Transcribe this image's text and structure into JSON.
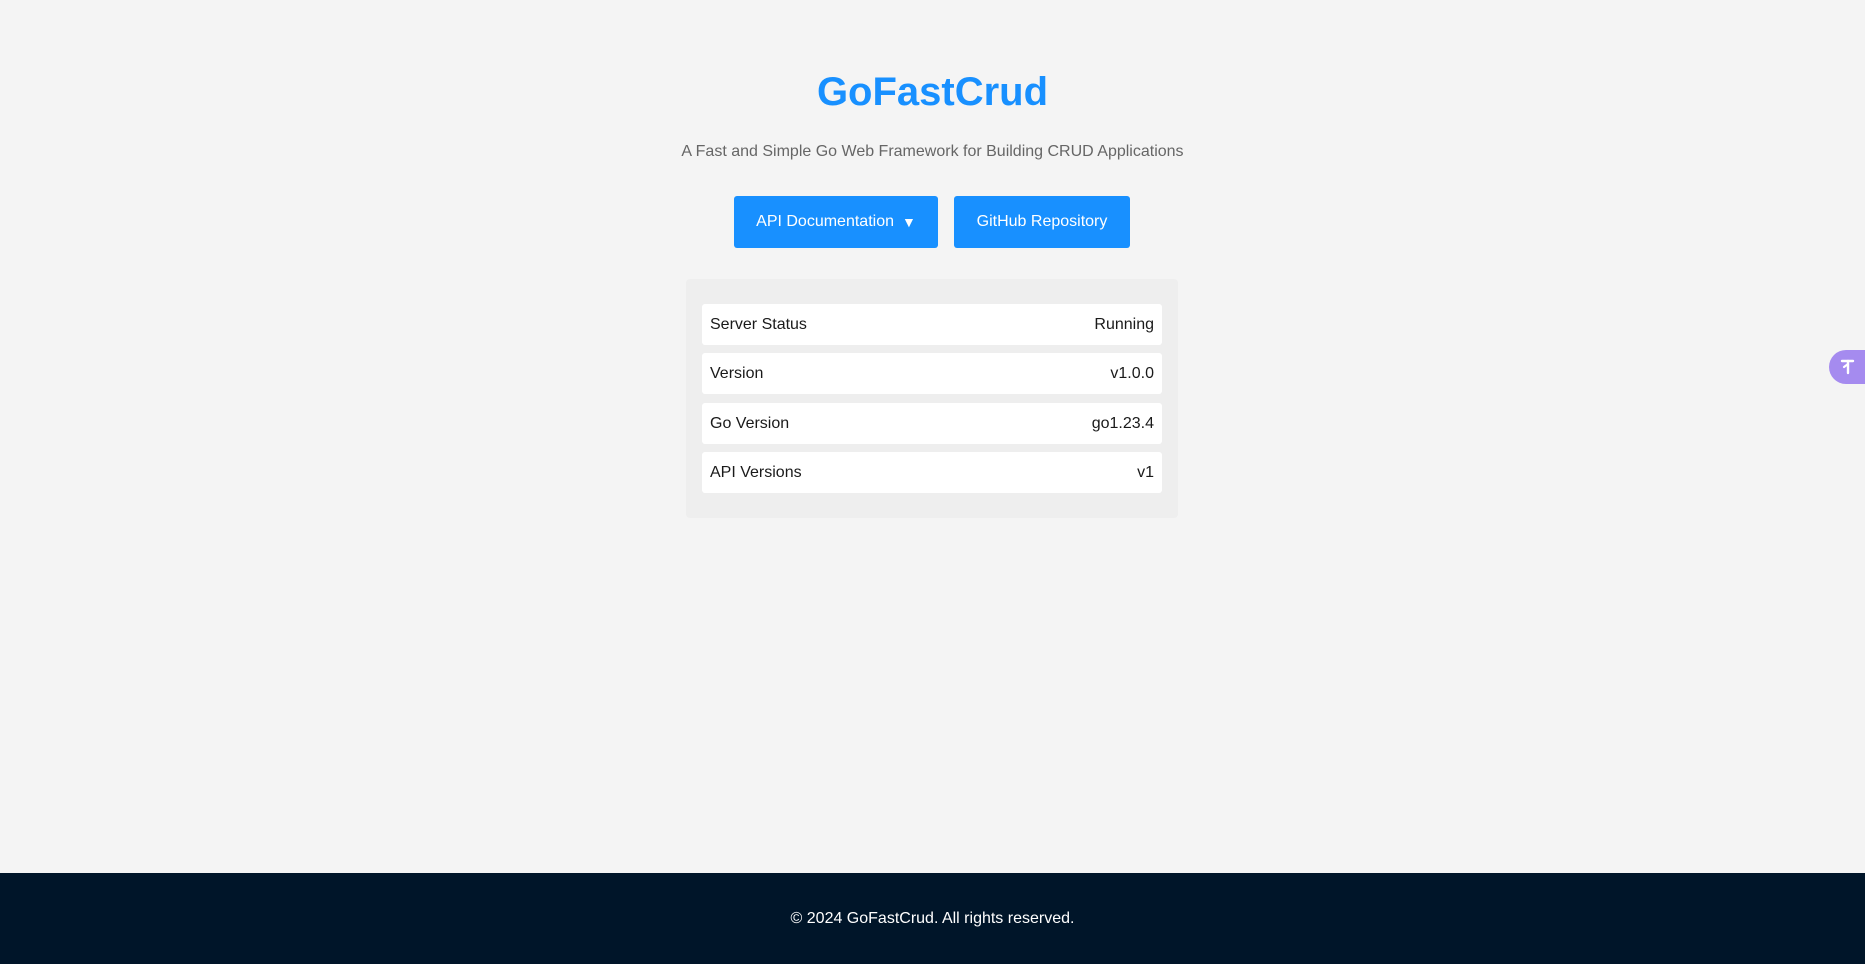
{
  "header": {
    "title": "GoFastCrud",
    "subtitle": "A Fast and Simple Go Web Framework for Building CRUD Applications"
  },
  "actions": {
    "docs_label": "API Documentation",
    "docs_caret": "▼",
    "github_label": "GitHub Repository"
  },
  "info": {
    "rows": [
      {
        "label": "Server Status",
        "value": "Running"
      },
      {
        "label": "Version",
        "value": "v1.0.0"
      },
      {
        "label": "Go Version",
        "value": "go1.23.4"
      },
      {
        "label": "API Versions",
        "value": "v1"
      }
    ]
  },
  "side_tab": {
    "icon": "translate-icon",
    "color": "#a58bef"
  },
  "footer": {
    "text": "© 2024 GoFastCrud. All rights reserved."
  },
  "colors": {
    "accent": "#1890ff",
    "footer_bg": "#001529",
    "page_bg": "#f4f4f4"
  }
}
